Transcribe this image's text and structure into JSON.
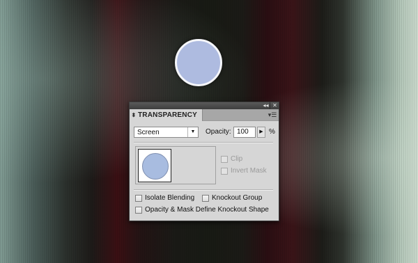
{
  "panel": {
    "tab_title": "TRANSPARENCY",
    "blend_mode": "Screen",
    "opacity_label": "Opacity:",
    "opacity_value": "100",
    "percent_symbol": "%",
    "clip_label": "Clip",
    "invert_mask_label": "Invert Mask",
    "isolate_blending_label": "Isolate Blending",
    "knockout_group_label": "Knockout Group",
    "opacity_mask_label": "Opacity & Mask Define Knockout Shape"
  },
  "checkboxes": {
    "clip_checked": false,
    "invert_mask_checked": false,
    "isolate_blending_checked": false,
    "knockout_group_checked": false,
    "opacity_mask_checked": false
  },
  "icons": {
    "collapse": "double-chevron-left-icon",
    "close": "close-icon",
    "tab_updown": "updown-arrows-icon",
    "panel_menu": "panel-menu-icon",
    "dropdown": "chevron-down-icon",
    "stepper": "triangle-right-icon"
  },
  "colors": {
    "panel_bg": "#d6d6d6",
    "circle_fill": "#aebbe0"
  }
}
